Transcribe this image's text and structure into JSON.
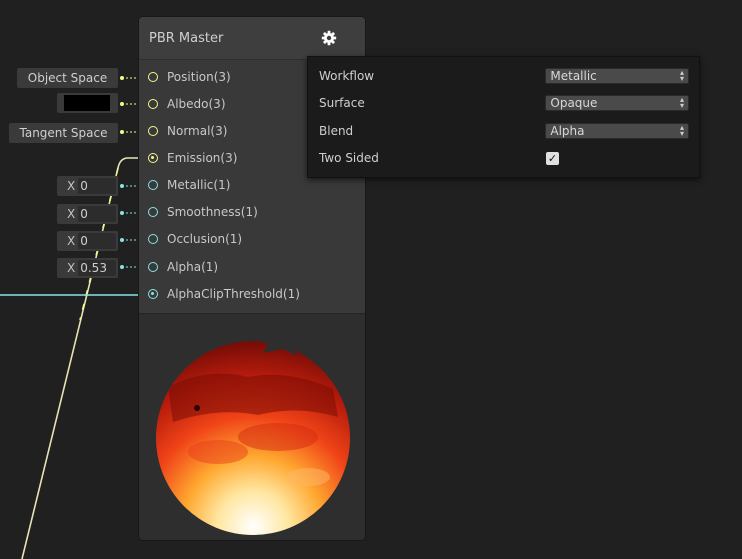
{
  "node": {
    "title": "PBR Master",
    "ports": [
      {
        "label": "Position(3)",
        "color": "#f6f88c",
        "connected": false
      },
      {
        "label": "Albedo(3)",
        "color": "#f6f88c",
        "connected": false
      },
      {
        "label": "Normal(3)",
        "color": "#f6f88c",
        "connected": false
      },
      {
        "label": "Emission(3)",
        "color": "#f6f88c",
        "connected": true
      },
      {
        "label": "Metallic(1)",
        "color": "#84e4e7",
        "connected": false
      },
      {
        "label": "Smoothness(1)",
        "color": "#84e4e7",
        "connected": false
      },
      {
        "label": "Occlusion(1)",
        "color": "#84e4e7",
        "connected": false
      },
      {
        "label": "Alpha(1)",
        "color": "#84e4e7",
        "connected": false
      },
      {
        "label": "AlphaClipThreshold(1)",
        "color": "#84e4e7",
        "connected": true
      }
    ]
  },
  "inputs": {
    "position": "Object Space",
    "albedo_color": "#000000",
    "normal": "Tangent Space",
    "x_label": "X",
    "metallic": "0",
    "smoothness": "0",
    "occlusion": "0",
    "alpha": "0.53"
  },
  "settings": {
    "workflow_label": "Workflow",
    "workflow_value": "Metallic",
    "surface_label": "Surface",
    "surface_value": "Opaque",
    "blend_label": "Blend",
    "blend_value": "Alpha",
    "two_sided_label": "Two Sided",
    "two_sided_checked": true
  },
  "colors": {
    "vector3": "#f6f88c",
    "vector1": "#84e4e7",
    "wire_pink": "#e6c6dc"
  },
  "icons": [
    "gear-icon",
    "checkmark-icon",
    "dropdown-arrow-icon"
  ]
}
